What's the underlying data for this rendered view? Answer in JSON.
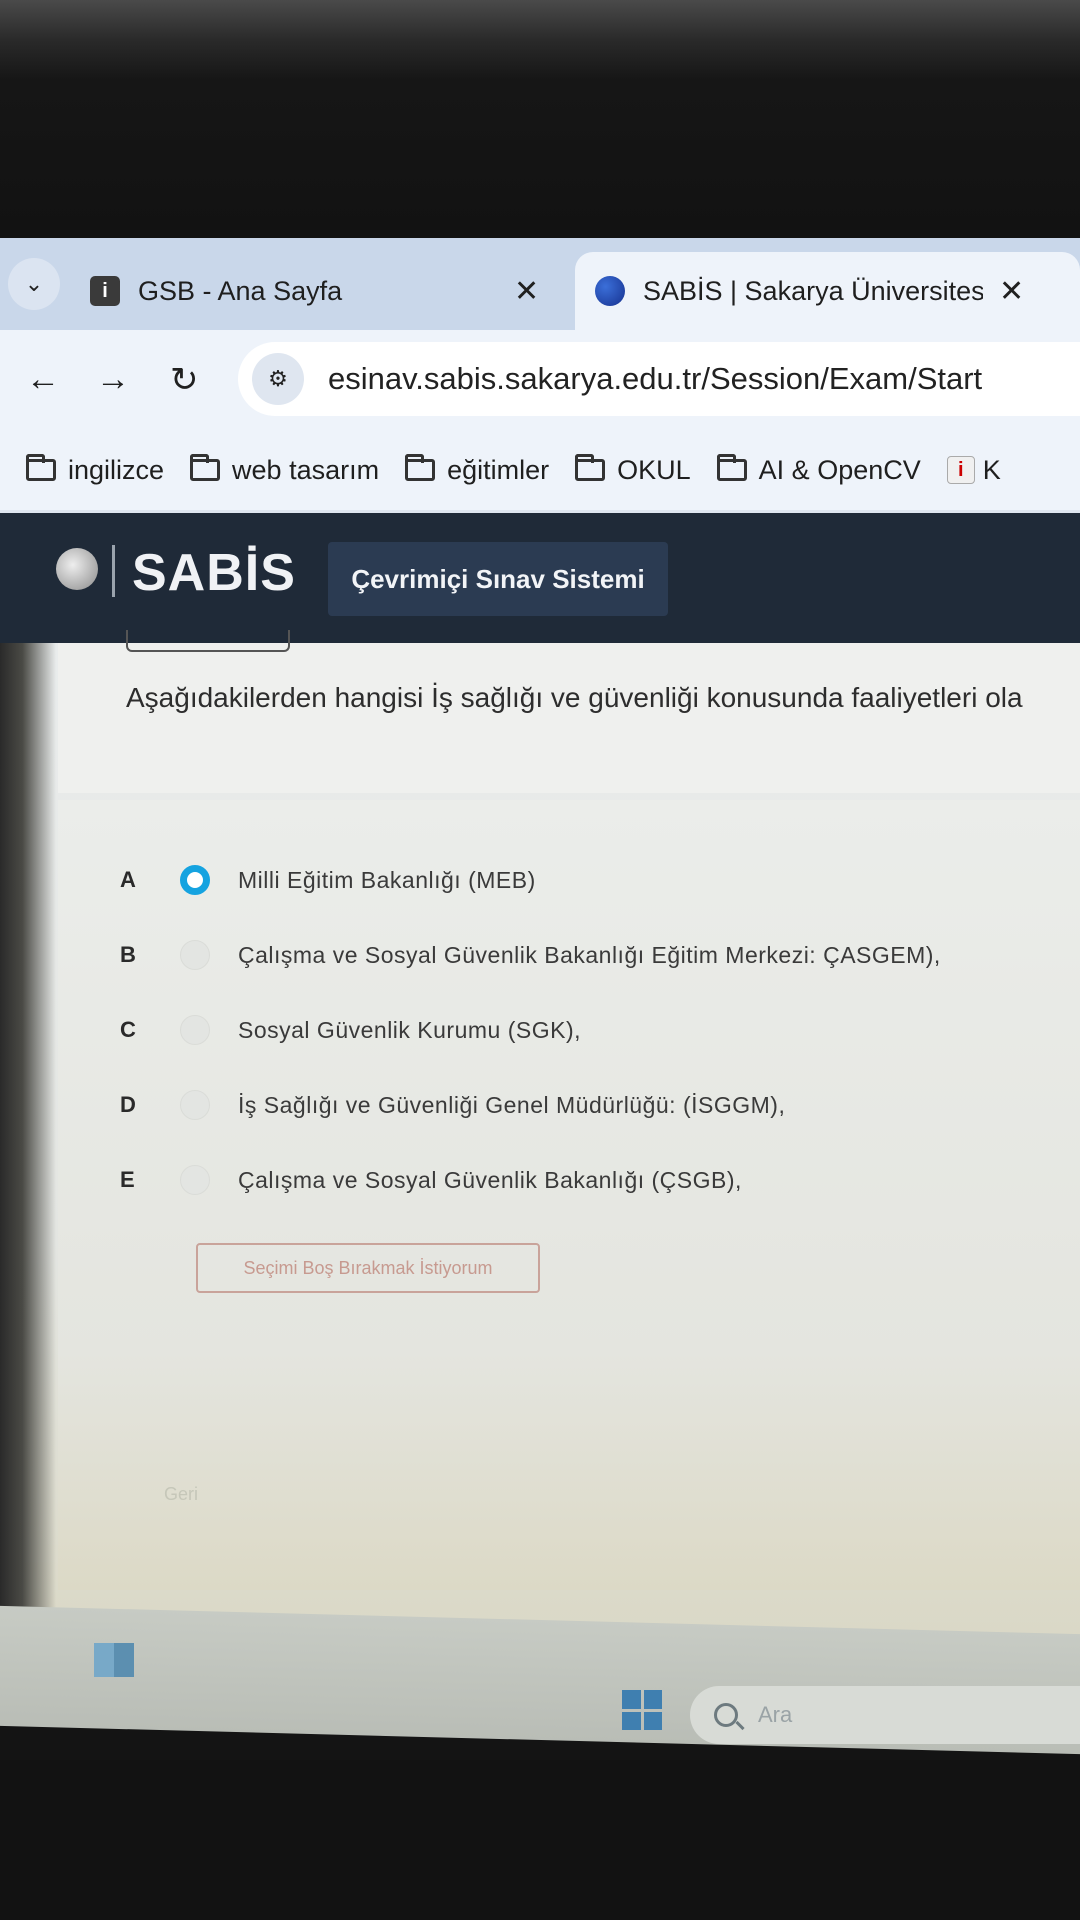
{
  "browser": {
    "tabs": [
      {
        "title": "GSB - Ana Sayfa",
        "favicon": "info-icon",
        "close": "✕"
      },
      {
        "title": "SABİS | Sakarya Üniversitesi Bilg",
        "favicon": "globe-icon",
        "close": "✕",
        "active": true
      }
    ],
    "url": "esinav.sabis.sakarya.edu.tr/Session/Exam/Start",
    "bookmarks": [
      {
        "label": "ingilizce",
        "icon": "folder-icon"
      },
      {
        "label": "web tasarım",
        "icon": "folder-icon"
      },
      {
        "label": "eğitimler",
        "icon": "folder-icon"
      },
      {
        "label": "OKUL",
        "icon": "folder-icon"
      },
      {
        "label": "AI & OpenCV",
        "icon": "folder-icon"
      },
      {
        "label": "K",
        "icon": "info-icon"
      }
    ]
  },
  "site": {
    "logo": "SABİS",
    "system_title": "Çevrimiçi Sınav Sistemi"
  },
  "exam": {
    "question": "Aşağıdakilerden hangisi İş sağlığı ve güvenliği konusunda faaliyetleri ola",
    "selected": "A",
    "options": [
      {
        "letter": "A",
        "text": "Milli Eğitim Bakanlığı (MEB)"
      },
      {
        "letter": "B",
        "text": "Çalışma ve Sosyal Güvenlik Bakanlığı Eğitim Merkezi: ÇASGEM),"
      },
      {
        "letter": "C",
        "text": "Sosyal Güvenlik Kurumu (SGK),"
      },
      {
        "letter": "D",
        "text": "İş Sağlığı ve Güvenliği Genel Müdürlüğü: (İSGGM),"
      },
      {
        "letter": "E",
        "text": "Çalışma ve Sosyal Güvenlik Bakanlığı (ÇSGB),"
      }
    ],
    "skip_label": "Seçimi Boş Bırakmak İstiyorum",
    "back_label": "Geri"
  },
  "taskbar": {
    "search_placeholder": "Ara"
  },
  "colors": {
    "header_bg": "#1f2a38",
    "radio_selected": "#15a3e0",
    "skip_border": "#c9a39a"
  }
}
